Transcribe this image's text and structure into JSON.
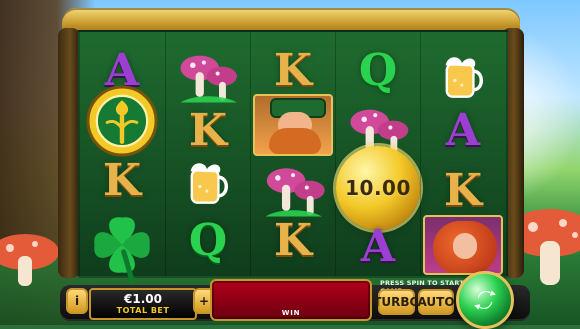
{
  "ui": {
    "hint": "PRESS SPIN TO START GAME",
    "bet": {
      "value": "€1.00",
      "label": "TOTAL BET"
    },
    "buttons": {
      "info": "i",
      "minus": "−",
      "plus": "+",
      "turbo": "TURBO",
      "auto": "AUTO"
    },
    "win_label": "WIN"
  },
  "reels": {
    "col1": {
      "r1": "A",
      "r3": "K"
    },
    "col2": {
      "r2": "K",
      "r4": "Q"
    },
    "col3": {
      "r1": "K",
      "r4": "K"
    },
    "col4": {
      "r1": "Q",
      "r4": "A"
    },
    "col5": {
      "r2": "A",
      "r3": "K"
    }
  },
  "coin_value": "10.00",
  "colors": {
    "gold": "#f3c928",
    "win_red": "#b3001a",
    "spin_green": "#2bd24f"
  },
  "icons": {
    "spin": "spin-arrows-icon",
    "clover": "four-leaf-clover-icon",
    "celtic": "celtic-tree-icon",
    "beer": "beer-mug-icon",
    "mushroom": "mushroom-icon",
    "coin": "coin-icon"
  }
}
